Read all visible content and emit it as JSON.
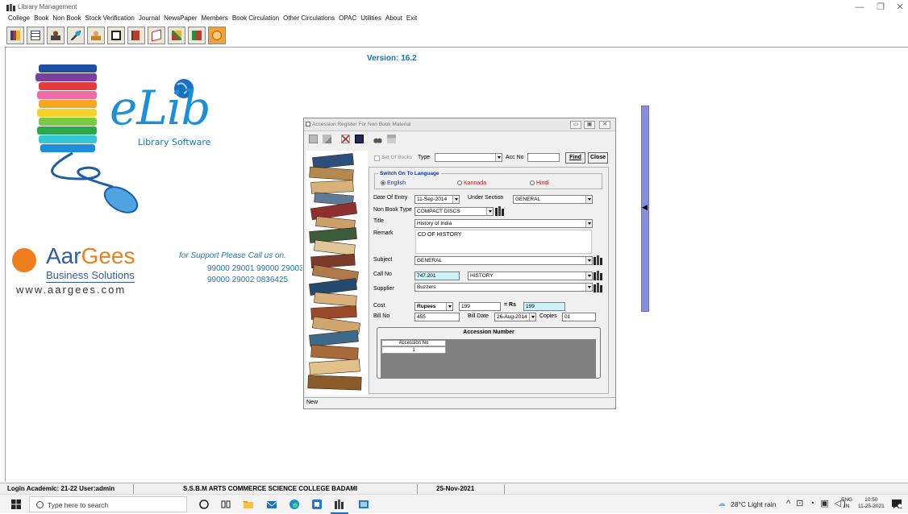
{
  "window": {
    "title": "Library Management",
    "controls": [
      "—",
      "❐",
      "✕"
    ]
  },
  "menu": [
    "College",
    "Book",
    "Non Book",
    "Stock Verification",
    "Journal",
    "NewsPaper",
    "Members",
    "Book Circulation",
    "Other Circulations",
    "OPAC",
    "Utilities",
    "About",
    "Exit"
  ],
  "toolbar_icons": [
    "books-icon",
    "table-icon",
    "reader-icon",
    "key-icon",
    "person-icon",
    "card-icon",
    "flag-icon",
    "book-open-icon",
    "tools-icon",
    "notebook-icon",
    "globe-icon"
  ],
  "branding": {
    "version": "Version: 16.2",
    "elib": "eLib",
    "elib_sub": "Library Software",
    "company_a": "Aar",
    "company_g": "Gees",
    "company_sub": "Business Solutions",
    "website": "www.aargees.com",
    "support_label": "for Support Please Call us on.",
    "phone_line1": "99000 29001    99000 29003",
    "phone_line2": "99000 29002    0836425"
  },
  "dialog": {
    "title": "Accession Register For Non Book Material",
    "set_of_books": "Set Of Books",
    "type_label": "Type",
    "type_value": "",
    "acc_no_label": "Acc No",
    "acc_no_value": "",
    "find": "Find",
    "close": "Close",
    "language_group": "Switch On To Language",
    "languages": [
      "English",
      "Kannada",
      "Hindi"
    ],
    "selected_language": "English",
    "fields": {
      "date_of_entry_label": "Date Of Entry",
      "date_of_entry": "11-Sep-2014",
      "under_section_label": "Under Section",
      "under_section": "GENERAL",
      "non_book_type_label": "Non Book Type",
      "non_book_type": "COMPACT DISCS",
      "title_label": "Title",
      "title": "History of India",
      "remark_label": "Remark",
      "remark": "CD OF HISTORY",
      "subject_label": "Subject",
      "subject": "GENERAL",
      "call_no_label": "Call No",
      "call_no": "747.201",
      "call_no_desc": "HISTORY",
      "supplier_label": "Supplier",
      "supplier": "Buzzers",
      "cost_label": "Cost",
      "currency": "Rupees",
      "cost": "199",
      "rs_label": "= Rs",
      "rs_value": "199",
      "bill_no_label": "Bill No",
      "bill_no": "455",
      "bill_date_label": "Bill Date",
      "bill_date": "26-Aug-2014",
      "copies_label": "Copies",
      "copies": "01"
    },
    "accession": {
      "title": "Accession Number",
      "column": "Accession No",
      "rows": [
        "1"
      ]
    },
    "status": "New"
  },
  "statusbar": {
    "login": "Login Academic: 21-22  User:admin",
    "college": "S.S.B.M ARTS COMMERCE SCIENCE COLLEGE BADAMI",
    "date": "25-Nov-2021"
  },
  "taskbar": {
    "search_placeholder": "Type here to search",
    "weather": "28°C  Light rain",
    "tray_icons": "^ ⊡ ◔ ▣ ◁)",
    "lang_1": "ENG",
    "lang_2": "IN",
    "time": "10:50",
    "date": "11-25-2021"
  },
  "colors": {
    "brand_blue": "#1c8fd9",
    "brand_orange": "#ee7d1e",
    "highlight_field": "#cdf2f7",
    "side_strip": "#8b8fdb"
  }
}
